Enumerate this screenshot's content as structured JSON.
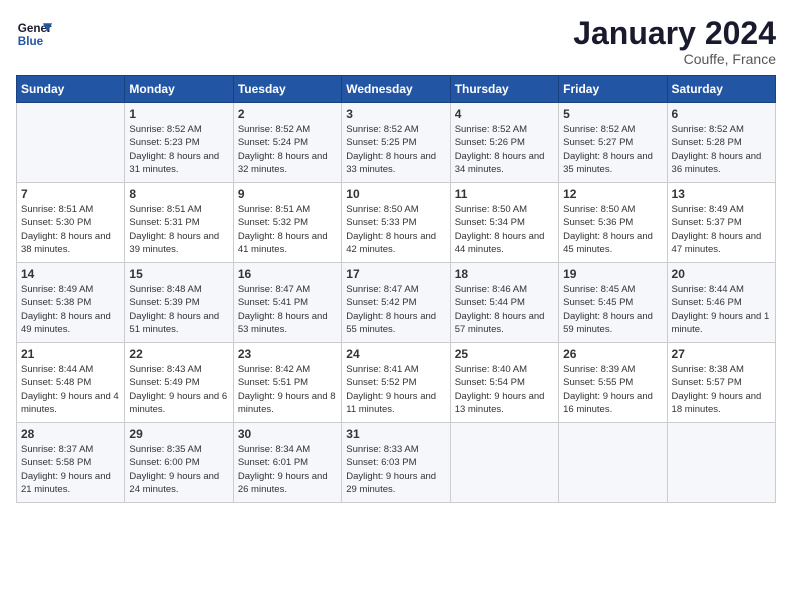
{
  "logo": {
    "line1": "General",
    "line2": "Blue"
  },
  "title": "January 2024",
  "location": "Couffe, France",
  "days_header": [
    "Sunday",
    "Monday",
    "Tuesday",
    "Wednesday",
    "Thursday",
    "Friday",
    "Saturday"
  ],
  "weeks": [
    [
      {
        "num": "",
        "sunrise": "",
        "sunset": "",
        "daylight": ""
      },
      {
        "num": "1",
        "sunrise": "Sunrise: 8:52 AM",
        "sunset": "Sunset: 5:23 PM",
        "daylight": "Daylight: 8 hours and 31 minutes."
      },
      {
        "num": "2",
        "sunrise": "Sunrise: 8:52 AM",
        "sunset": "Sunset: 5:24 PM",
        "daylight": "Daylight: 8 hours and 32 minutes."
      },
      {
        "num": "3",
        "sunrise": "Sunrise: 8:52 AM",
        "sunset": "Sunset: 5:25 PM",
        "daylight": "Daylight: 8 hours and 33 minutes."
      },
      {
        "num": "4",
        "sunrise": "Sunrise: 8:52 AM",
        "sunset": "Sunset: 5:26 PM",
        "daylight": "Daylight: 8 hours and 34 minutes."
      },
      {
        "num": "5",
        "sunrise": "Sunrise: 8:52 AM",
        "sunset": "Sunset: 5:27 PM",
        "daylight": "Daylight: 8 hours and 35 minutes."
      },
      {
        "num": "6",
        "sunrise": "Sunrise: 8:52 AM",
        "sunset": "Sunset: 5:28 PM",
        "daylight": "Daylight: 8 hours and 36 minutes."
      }
    ],
    [
      {
        "num": "7",
        "sunrise": "Sunrise: 8:51 AM",
        "sunset": "Sunset: 5:30 PM",
        "daylight": "Daylight: 8 hours and 38 minutes."
      },
      {
        "num": "8",
        "sunrise": "Sunrise: 8:51 AM",
        "sunset": "Sunset: 5:31 PM",
        "daylight": "Daylight: 8 hours and 39 minutes."
      },
      {
        "num": "9",
        "sunrise": "Sunrise: 8:51 AM",
        "sunset": "Sunset: 5:32 PM",
        "daylight": "Daylight: 8 hours and 41 minutes."
      },
      {
        "num": "10",
        "sunrise": "Sunrise: 8:50 AM",
        "sunset": "Sunset: 5:33 PM",
        "daylight": "Daylight: 8 hours and 42 minutes."
      },
      {
        "num": "11",
        "sunrise": "Sunrise: 8:50 AM",
        "sunset": "Sunset: 5:34 PM",
        "daylight": "Daylight: 8 hours and 44 minutes."
      },
      {
        "num": "12",
        "sunrise": "Sunrise: 8:50 AM",
        "sunset": "Sunset: 5:36 PM",
        "daylight": "Daylight: 8 hours and 45 minutes."
      },
      {
        "num": "13",
        "sunrise": "Sunrise: 8:49 AM",
        "sunset": "Sunset: 5:37 PM",
        "daylight": "Daylight: 8 hours and 47 minutes."
      }
    ],
    [
      {
        "num": "14",
        "sunrise": "Sunrise: 8:49 AM",
        "sunset": "Sunset: 5:38 PM",
        "daylight": "Daylight: 8 hours and 49 minutes."
      },
      {
        "num": "15",
        "sunrise": "Sunrise: 8:48 AM",
        "sunset": "Sunset: 5:39 PM",
        "daylight": "Daylight: 8 hours and 51 minutes."
      },
      {
        "num": "16",
        "sunrise": "Sunrise: 8:47 AM",
        "sunset": "Sunset: 5:41 PM",
        "daylight": "Daylight: 8 hours and 53 minutes."
      },
      {
        "num": "17",
        "sunrise": "Sunrise: 8:47 AM",
        "sunset": "Sunset: 5:42 PM",
        "daylight": "Daylight: 8 hours and 55 minutes."
      },
      {
        "num": "18",
        "sunrise": "Sunrise: 8:46 AM",
        "sunset": "Sunset: 5:44 PM",
        "daylight": "Daylight: 8 hours and 57 minutes."
      },
      {
        "num": "19",
        "sunrise": "Sunrise: 8:45 AM",
        "sunset": "Sunset: 5:45 PM",
        "daylight": "Daylight: 8 hours and 59 minutes."
      },
      {
        "num": "20",
        "sunrise": "Sunrise: 8:44 AM",
        "sunset": "Sunset: 5:46 PM",
        "daylight": "Daylight: 9 hours and 1 minute."
      }
    ],
    [
      {
        "num": "21",
        "sunrise": "Sunrise: 8:44 AM",
        "sunset": "Sunset: 5:48 PM",
        "daylight": "Daylight: 9 hours and 4 minutes."
      },
      {
        "num": "22",
        "sunrise": "Sunrise: 8:43 AM",
        "sunset": "Sunset: 5:49 PM",
        "daylight": "Daylight: 9 hours and 6 minutes."
      },
      {
        "num": "23",
        "sunrise": "Sunrise: 8:42 AM",
        "sunset": "Sunset: 5:51 PM",
        "daylight": "Daylight: 9 hours and 8 minutes."
      },
      {
        "num": "24",
        "sunrise": "Sunrise: 8:41 AM",
        "sunset": "Sunset: 5:52 PM",
        "daylight": "Daylight: 9 hours and 11 minutes."
      },
      {
        "num": "25",
        "sunrise": "Sunrise: 8:40 AM",
        "sunset": "Sunset: 5:54 PM",
        "daylight": "Daylight: 9 hours and 13 minutes."
      },
      {
        "num": "26",
        "sunrise": "Sunrise: 8:39 AM",
        "sunset": "Sunset: 5:55 PM",
        "daylight": "Daylight: 9 hours and 16 minutes."
      },
      {
        "num": "27",
        "sunrise": "Sunrise: 8:38 AM",
        "sunset": "Sunset: 5:57 PM",
        "daylight": "Daylight: 9 hours and 18 minutes."
      }
    ],
    [
      {
        "num": "28",
        "sunrise": "Sunrise: 8:37 AM",
        "sunset": "Sunset: 5:58 PM",
        "daylight": "Daylight: 9 hours and 21 minutes."
      },
      {
        "num": "29",
        "sunrise": "Sunrise: 8:35 AM",
        "sunset": "Sunset: 6:00 PM",
        "daylight": "Daylight: 9 hours and 24 minutes."
      },
      {
        "num": "30",
        "sunrise": "Sunrise: 8:34 AM",
        "sunset": "Sunset: 6:01 PM",
        "daylight": "Daylight: 9 hours and 26 minutes."
      },
      {
        "num": "31",
        "sunrise": "Sunrise: 8:33 AM",
        "sunset": "Sunset: 6:03 PM",
        "daylight": "Daylight: 9 hours and 29 minutes."
      },
      {
        "num": "",
        "sunrise": "",
        "sunset": "",
        "daylight": ""
      },
      {
        "num": "",
        "sunrise": "",
        "sunset": "",
        "daylight": ""
      },
      {
        "num": "",
        "sunrise": "",
        "sunset": "",
        "daylight": ""
      }
    ]
  ]
}
